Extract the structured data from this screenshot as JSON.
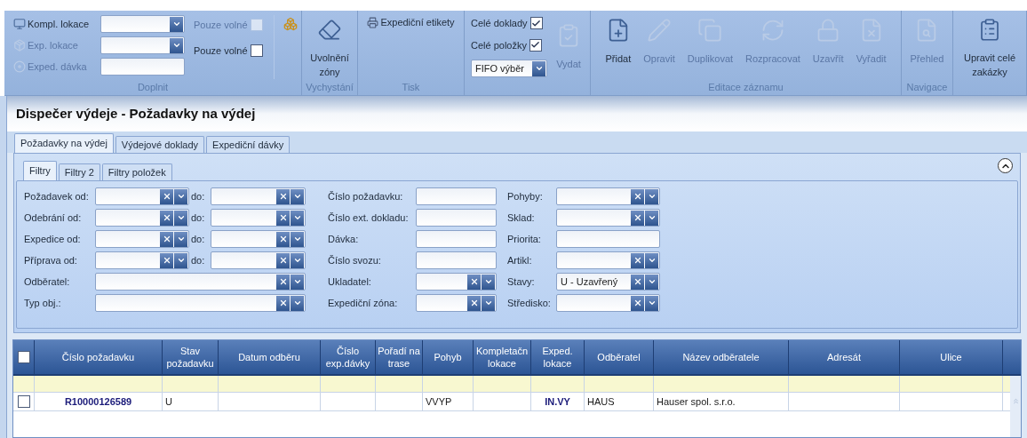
{
  "ribbon": {
    "groups": [
      {
        "label": "Doplnit",
        "kind": "fill",
        "fields": [
          {
            "label": "Kompl. lokace",
            "kind": "combo",
            "disabled": false
          },
          {
            "label": "Exp. lokace",
            "kind": "combo",
            "disabled": true
          },
          {
            "label": "Exped. dávka",
            "kind": "text",
            "disabled": true
          }
        ],
        "checks": [
          {
            "label": "Pouze volné",
            "checked": false,
            "disabled": true
          },
          {
            "label": "Pouze volné",
            "checked": false,
            "disabled": false
          }
        ]
      },
      {
        "label": "Vychystání",
        "kind": "large",
        "buttons": [
          {
            "label": "Uvolnění zóny",
            "disabled": false
          }
        ]
      },
      {
        "label": "Tisk",
        "kind": "small",
        "buttons": [
          {
            "label": "Expediční etikety",
            "disabled": false
          }
        ]
      },
      {
        "kind": "issue",
        "checks": [
          {
            "label": "Celé doklady",
            "checked": true,
            "disabled": false
          },
          {
            "label": "Celé položky",
            "checked": true,
            "disabled": false
          }
        ],
        "select": {
          "value": "FIFO výběr"
        },
        "buttons": [
          {
            "label": "Vydat",
            "disabled": true
          }
        ]
      },
      {
        "label": "Editace záznamu",
        "kind": "large",
        "buttons": [
          {
            "label": "Přidat",
            "disabled": false
          },
          {
            "label": "Opravit",
            "disabled": true
          },
          {
            "label": "Duplikovat",
            "disabled": true
          },
          {
            "label": "Rozpracovat",
            "disabled": true
          },
          {
            "label": "Uzavřít",
            "disabled": true
          },
          {
            "label": "Vyřadit",
            "disabled": true
          }
        ]
      },
      {
        "label": "Navigace",
        "kind": "large",
        "buttons": [
          {
            "label": "Přehled",
            "disabled": true
          }
        ]
      },
      {
        "kind": "large",
        "buttons": [
          {
            "label": "Upravit celé zakázky",
            "disabled": false
          }
        ]
      }
    ]
  },
  "title": "Dispečer výdeje - Požadavky na výdej",
  "tabs": [
    {
      "label": "Požadavky na výdej",
      "selected": true
    },
    {
      "label": "Výdejové doklady",
      "selected": false
    },
    {
      "label": "Expediční dávky",
      "selected": false
    }
  ],
  "filter_tabs": [
    {
      "label": "Filtry",
      "selected": true
    },
    {
      "label": "Filtry 2",
      "selected": false
    },
    {
      "label": "Filtry položek",
      "selected": false
    }
  ],
  "filters": {
    "columns": [
      [
        {
          "label": "Požadavek od:",
          "kind": "range",
          "to_label": "do:"
        },
        {
          "label": "Odebrání od:",
          "kind": "range",
          "to_label": "do:"
        },
        {
          "label": "Expedice od:",
          "kind": "range",
          "to_label": "do:"
        },
        {
          "label": "Příprava od:",
          "kind": "range",
          "to_label": "do:"
        },
        {
          "label": "Odběratel:",
          "kind": "wide"
        },
        {
          "label": "Typ obj.:",
          "kind": "wide"
        }
      ],
      [
        {
          "label": "Číslo požadavku:",
          "kind": "text"
        },
        {
          "label": "Číslo ext. dokladu:",
          "kind": "text"
        },
        {
          "label": "Dávka:",
          "kind": "text"
        },
        {
          "label": "Číslo svozu:",
          "kind": "text"
        },
        {
          "label": "Ukladatel:",
          "kind": "combo"
        },
        {
          "label": "Expediční zóna:",
          "kind": "combo"
        }
      ],
      [
        {
          "label": "Pohyby:",
          "kind": "combo"
        },
        {
          "label": "Sklad:",
          "kind": "combo"
        },
        {
          "label": "Priorita:",
          "kind": "text"
        },
        {
          "label": "Artikl:",
          "kind": "combo"
        },
        {
          "label": "Stavy:",
          "kind": "combo",
          "value": "U - Uzavřený"
        },
        {
          "label": "Středisko:",
          "kind": "combo"
        }
      ]
    ]
  },
  "grid": {
    "all_checked": false,
    "columns": [
      {
        "label": "Číslo požadavku"
      },
      {
        "label": "Stav požadavku"
      },
      {
        "label": "Datum odběru"
      },
      {
        "label": "Číslo exp.dávky"
      },
      {
        "label": "Pořadí na trase"
      },
      {
        "label": "Pohyb"
      },
      {
        "label": "Kompletačn lokace"
      },
      {
        "label": "Exped. lokace"
      },
      {
        "label": "Odběratel"
      },
      {
        "label": "Název odběratele"
      },
      {
        "label": "Adresát"
      },
      {
        "label": "Ulice"
      }
    ],
    "rows": [
      {
        "checked": false,
        "cells": [
          {
            "text": "R10000126589",
            "link": true
          },
          {
            "text": "U",
            "link": false
          },
          null,
          null,
          null,
          {
            "text": "VVYP",
            "link": false
          },
          null,
          {
            "text": "IN.VY",
            "link": true
          },
          {
            "text": "HAUS",
            "link": false
          },
          {
            "text": "Hauser spol. s.r.o.",
            "link": false
          },
          null,
          null
        ]
      }
    ]
  }
}
